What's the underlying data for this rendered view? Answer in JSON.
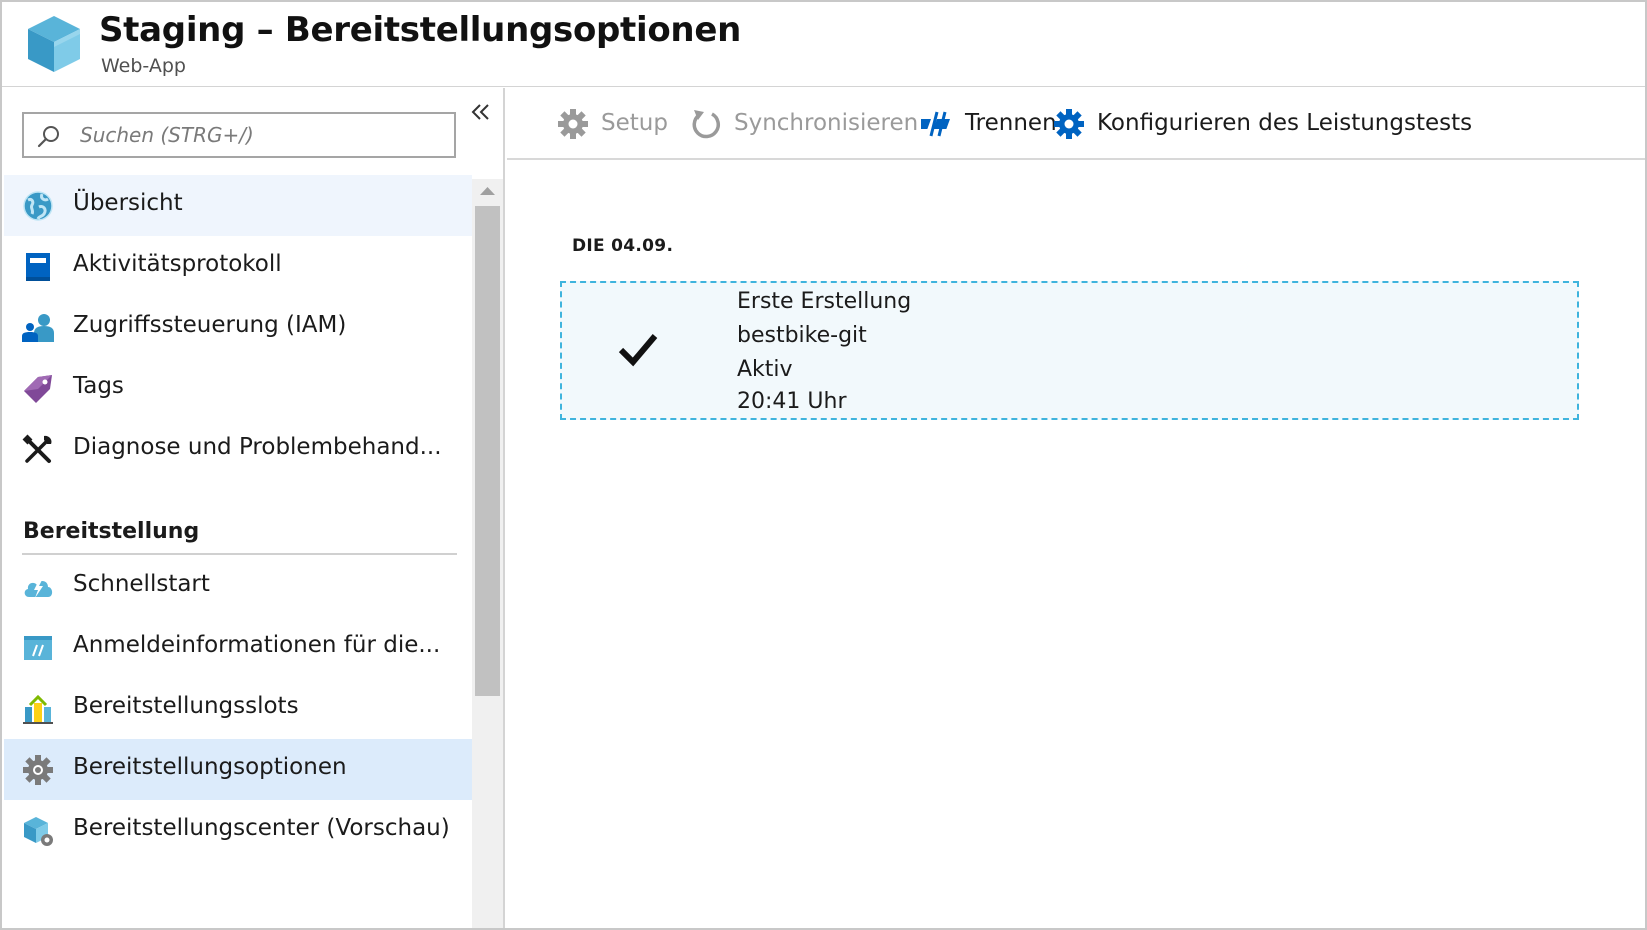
{
  "header": {
    "title": "Staging – Bereitstellungsoptionen",
    "subtitle": "Web-App",
    "logo_icon": "azure-cube-icon"
  },
  "sidebar": {
    "search": {
      "placeholder": "Suchen (STRG+/)",
      "value": ""
    },
    "collapse_icon": "chevron-double-left-icon",
    "items": [
      {
        "label": "Übersicht",
        "icon": "globe-icon",
        "state": "hover"
      },
      {
        "label": "Aktivitätsprotokoll",
        "icon": "book-icon"
      },
      {
        "label": "Zugriffssteuerung (IAM)",
        "icon": "people-icon"
      },
      {
        "label": "Tags",
        "icon": "tag-icon"
      },
      {
        "label": "Diagnose und Problembehand...",
        "icon": "wrench-screwdriver-icon"
      }
    ],
    "section": {
      "title": "Bereitstellung",
      "items": [
        {
          "label": "Schnellstart",
          "icon": "cloud-bolt-icon"
        },
        {
          "label": "Anmeldeinformationen für die...",
          "icon": "credentials-window-icon"
        },
        {
          "label": "Bereitstellungsslots",
          "icon": "slots-icon"
        },
        {
          "label": "Bereitstellungsoptionen",
          "icon": "gear-icon",
          "state": "selected"
        },
        {
          "label": "Bereitstellungscenter (Vorschau)",
          "icon": "deployment-center-icon"
        }
      ]
    }
  },
  "toolbar": {
    "setup": {
      "label": "Setup",
      "icon": "gear-icon",
      "enabled": false
    },
    "sync": {
      "label": "Synchronisieren",
      "icon": "refresh-icon",
      "enabled": false
    },
    "disconnect": {
      "label": "Trennen",
      "icon": "disconnect-icon",
      "enabled": true
    },
    "loadtest": {
      "label": "Konfigurieren des Leistungstests",
      "icon": "gear-icon",
      "enabled": true
    }
  },
  "deployments": {
    "date_heading": "DIE 04.09.",
    "entry": {
      "status_icon": "checkmark-icon",
      "message": "Erste Erstellung",
      "source": "bestbike-git",
      "status": "Aktiv",
      "time": "20:41 Uhr"
    }
  },
  "colors": {
    "accent_blue": "#0063c1",
    "selected_bg": "#dcebfb",
    "hover_bg": "#eff5fd",
    "entry_border": "#3fb4dd",
    "entry_bg": "#f2f9fc",
    "disabled_text": "#9a9a9a"
  }
}
